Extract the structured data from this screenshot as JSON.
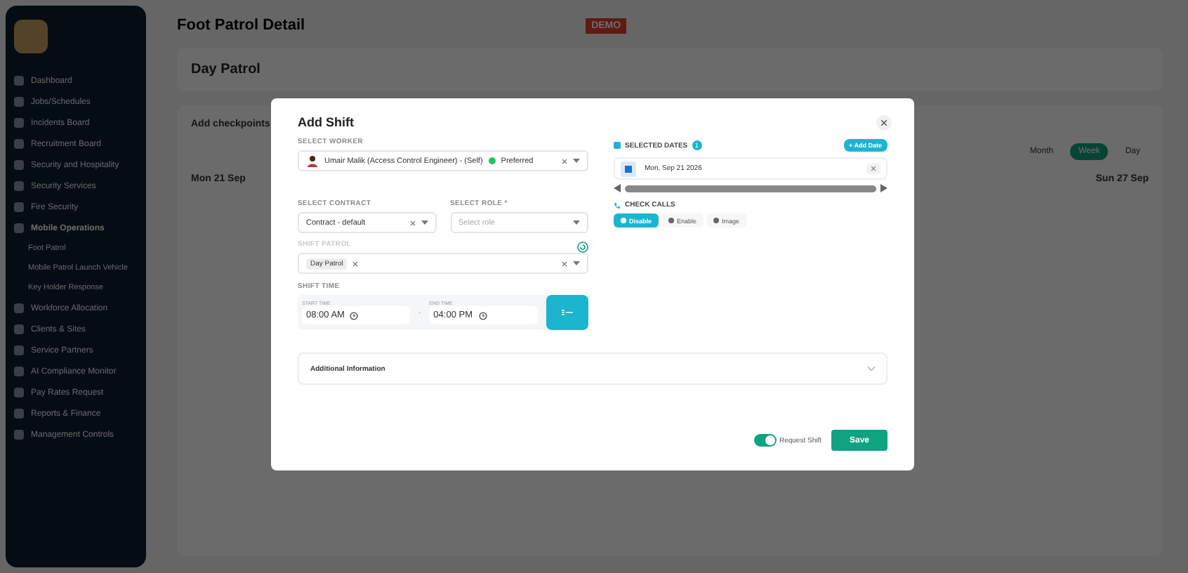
{
  "sidebar": {
    "items": [
      {
        "label": "Dashboard",
        "selected": false
      },
      {
        "label": "Jobs/Schedules",
        "selected": false
      },
      {
        "label": "Incidents Board",
        "selected": false
      },
      {
        "label": "Recruitment Board",
        "selected": false
      },
      {
        "label": "Security and Hospitality",
        "selected": false
      },
      {
        "label": "Security Services",
        "selected": false
      },
      {
        "label": "Fire Security",
        "selected": false
      },
      {
        "label": "Mobile Operations",
        "selected": true,
        "children": [
          {
            "label": "Foot Patrol"
          },
          {
            "label": "Mobile Patrol Launch Vehicle"
          },
          {
            "label": "Key Holder Response"
          }
        ]
      },
      {
        "label": "Workforce Allocation",
        "selected": false
      },
      {
        "label": "Clients & Sites",
        "selected": false
      },
      {
        "label": "Service Partners",
        "selected": false
      },
      {
        "label": "AI Compliance Monitor",
        "selected": false
      },
      {
        "label": "Pay Rates Request",
        "selected": false
      },
      {
        "label": "Reports & Finance",
        "selected": false
      },
      {
        "label": "Management Controls",
        "selected": false
      }
    ]
  },
  "header": {
    "title": "Foot Patrol Detail",
    "badge": "DEMO"
  },
  "patrol": {
    "name": "Day Patrol"
  },
  "page": {
    "tab": "Add checkpoints",
    "views": [
      {
        "label": "Month",
        "selected": false
      },
      {
        "label": "Week",
        "selected": true
      },
      {
        "label": "Day",
        "selected": false
      }
    ],
    "day_headers": [
      "Mon 21 Sep",
      "Sun 27 Sep"
    ]
  },
  "modal": {
    "title": "Add Shift",
    "worker": {
      "label": "SELECT WORKER",
      "value": "Umair Malik (Access Control Engineer) - (Self)",
      "tag": "Preferred"
    },
    "contract": {
      "label": "SELECT CONTRACT",
      "value": "Contract - default"
    },
    "role": {
      "label": "SELECT ROLE *",
      "placeholder": "Select role"
    },
    "patrol": {
      "label": "SHIFT PATROL",
      "chips": [
        "Day Patrol"
      ]
    },
    "shift_time": {
      "label": "SHIFT TIME",
      "start_label": "START TIME",
      "start": "08:00 AM",
      "separator": "-",
      "end_label": "END TIME",
      "end": "04:00 PM"
    },
    "additional": {
      "label": "Additional Information",
      "expanded": false
    },
    "dates": {
      "label": "SELECTED DATES",
      "count": "1",
      "add": "+ Add Date",
      "items": [
        "Mon, Sep 21 2026"
      ]
    },
    "check_calls": {
      "label": "CHECK CALLS",
      "options": [
        {
          "label": "Disable",
          "selected": true
        },
        {
          "label": "Enable",
          "selected": false
        },
        {
          "label": "Image",
          "selected": false
        }
      ]
    },
    "request_shift": {
      "label": "Request Shift",
      "on": true
    },
    "save": "Save"
  }
}
